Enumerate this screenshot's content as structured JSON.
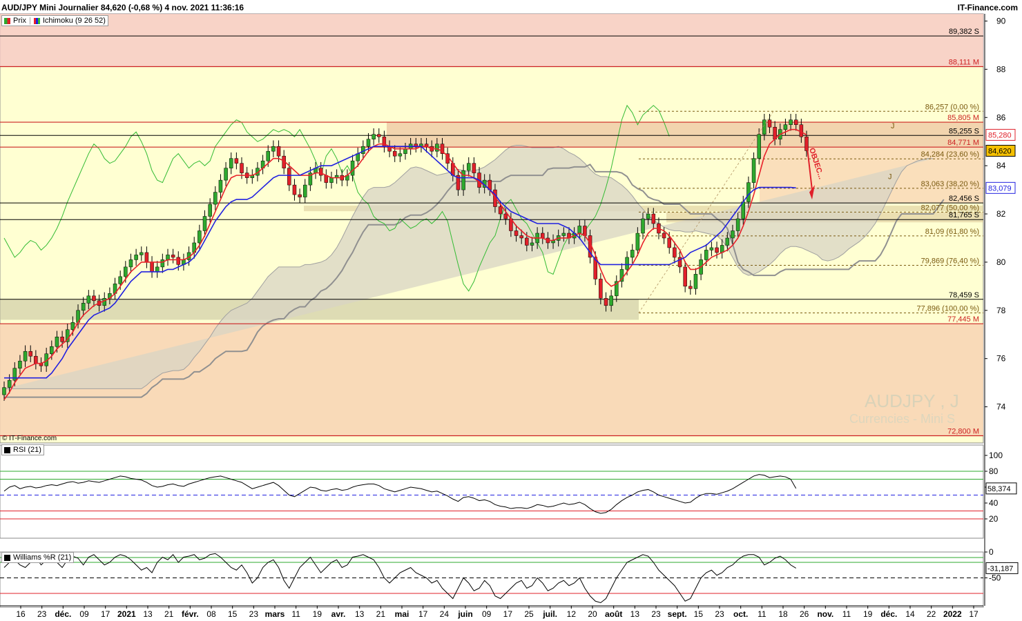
{
  "header": {
    "title": "AUD/JPY Mini Journalier 84,620 (-0,68 %) 4 nov. 2021 11:36:16",
    "brand": "IT-Finance.com",
    "copyright": "© IT-Finance.com",
    "watermark_symbol": "AUDJPY , J",
    "watermark_sub": "Currencies - Mini S"
  },
  "legends": {
    "price": "Prix",
    "ichimoku": "Ichimoku (9 26 52)",
    "rsi": "RSI (21)",
    "williams": "Williams %R (21)"
  },
  "colors": {
    "up": "#2ea82e",
    "down": "#e0202a",
    "tenkan": "#e8202a",
    "kijun": "#2020e0",
    "chikou": "#33bb33",
    "kumo_line": "#a0a0a0",
    "panel_bg": "#ffffd2"
  },
  "annotations": {
    "objective_label": "OBJEC...",
    "j_label": "J"
  },
  "chart_data": [
    {
      "type": "candlestick",
      "ylim": [
        72.5,
        90.3
      ],
      "y_ticks": [
        74,
        76,
        78,
        80,
        82,
        84,
        86,
        88,
        90
      ],
      "x_tick_labels": [
        "16",
        "23",
        "déc.",
        "09",
        "17",
        "2021",
        "13",
        "21",
        "févr.",
        "08",
        "15",
        "23",
        "mars",
        "11",
        "19",
        "avr.",
        "13",
        "21",
        "mai",
        "17",
        "24",
        "juin",
        "09",
        "17",
        "25",
        "juil.",
        "12",
        "20",
        "août",
        "13",
        "23",
        "sept.",
        "15",
        "23",
        "oct.",
        "11",
        "18",
        "26",
        "nov.",
        "11",
        "19",
        "déc.",
        "14",
        "22",
        "2022",
        "17"
      ],
      "price_levels": [
        {
          "value": 89.382,
          "label": "89,382 S",
          "color": "#000000"
        },
        {
          "value": 88.111,
          "label": "88,111 M",
          "color": "#cc2222"
        },
        {
          "value": 86.257,
          "label": "86,257 (0,00 %)",
          "color": "#7a5a10"
        },
        {
          "value": 85.805,
          "label": "85,805 M",
          "color": "#cc2222"
        },
        {
          "value": 85.255,
          "label": "85,255 S",
          "color": "#000000"
        },
        {
          "value": 84.771,
          "label": "84,771 M",
          "color": "#cc2222"
        },
        {
          "value": 84.284,
          "label": "84,284 (23,60 %)",
          "color": "#7a5a10"
        },
        {
          "value": 83.063,
          "label": "83,063 (38,20 %)",
          "color": "#7a5a10"
        },
        {
          "value": 82.456,
          "label": "82,456 S",
          "color": "#000000"
        },
        {
          "value": 82.077,
          "label": "82,077 (50,00 %)",
          "color": "#7a5a10"
        },
        {
          "value": 81.765,
          "label": "81,765 S",
          "color": "#000000"
        },
        {
          "value": 81.09,
          "label": "81,09 (61,80 %)",
          "color": "#7a5a10"
        },
        {
          "value": 79.869,
          "label": "79,869 (76,40 %)",
          "color": "#7a5a10"
        },
        {
          "value": 78.459,
          "label": "78,459 S",
          "color": "#000000"
        },
        {
          "value": 77.896,
          "label": "77,896 (100,00 %)",
          "color": "#7a5a10"
        },
        {
          "value": 77.445,
          "label": "77,445 M",
          "color": "#cc2222"
        },
        {
          "value": 72.8,
          "label": "72,800 M",
          "color": "#cc2222"
        }
      ],
      "current_price": {
        "value": 84.62,
        "label": "84,620"
      },
      "kijun_value": {
        "value": 83.079,
        "label": "83,079"
      },
      "tenkan_value": {
        "value": 85.28,
        "label": "85,280"
      },
      "close": [
        74.8,
        75.1,
        75.6,
        75.9,
        76.3,
        76.1,
        75.8,
        75.7,
        76.2,
        76.5,
        76.9,
        76.7,
        77.2,
        77.5,
        78.0,
        78.3,
        78.6,
        78.4,
        78.2,
        78.5,
        78.7,
        79.1,
        79.4,
        79.8,
        80.1,
        80.3,
        80.4,
        80.0,
        79.6,
        79.8,
        80.1,
        80.3,
        80.2,
        79.9,
        80.1,
        80.4,
        80.8,
        81.3,
        81.9,
        82.4,
        82.9,
        83.4,
        83.9,
        84.3,
        84.1,
        83.7,
        83.5,
        83.6,
        83.9,
        84.2,
        84.6,
        84.8,
        84.4,
        83.9,
        83.2,
        82.8,
        82.7,
        83.2,
        83.7,
        83.9,
        83.6,
        83.3,
        83.5,
        83.6,
        83.4,
        83.6,
        84.2,
        84.5,
        84.8,
        85.1,
        85.3,
        85.2,
        84.8,
        84.6,
        84.4,
        84.5,
        84.7,
        84.9,
        84.8,
        84.9,
        84.8,
        84.6,
        84.9,
        84.5,
        84.1,
        83.6,
        83.0,
        83.8,
        84.1,
        83.7,
        83.1,
        83.4,
        83.0,
        82.3,
        82.0,
        81.8,
        81.3,
        81.1,
        81.0,
        80.7,
        80.8,
        81.2,
        81.0,
        80.8,
        80.9,
        81.1,
        81.2,
        81.0,
        81.2,
        81.5,
        81.1,
        80.2,
        79.3,
        78.5,
        78.2,
        78.6,
        79.2,
        79.7,
        80.2,
        80.5,
        81.2,
        81.8,
        82.0,
        81.6,
        81.2,
        81.0,
        80.6,
        80.2,
        79.8,
        79.0,
        78.9,
        79.5,
        80.1,
        80.5,
        80.6,
        80.4,
        80.7,
        81.0,
        81.3,
        81.8,
        82.5,
        83.3,
        84.3,
        85.3,
        85.9,
        85.6,
        85.1,
        85.5,
        85.7,
        85.9,
        85.7,
        85.2,
        84.62
      ],
      "tenkan": [
        74.3,
        74.6,
        75.0,
        75.3,
        75.6,
        75.7,
        75.8,
        75.8,
        75.9,
        76.1,
        76.4,
        76.6,
        76.8,
        77.1,
        77.5,
        77.8,
        78.0,
        78.2,
        78.3,
        78.4,
        78.5,
        78.7,
        79.0,
        79.3,
        79.6,
        79.8,
        80.0,
        80.0,
        80.0,
        80.0,
        80.0,
        80.1,
        80.1,
        80.1,
        80.1,
        80.2,
        80.4,
        80.7,
        81.1,
        81.6,
        82.1,
        82.6,
        83.1,
        83.5,
        83.6,
        83.6,
        83.6,
        83.6,
        83.7,
        83.9,
        84.1,
        84.3,
        84.3,
        84.2,
        84.0,
        83.8,
        83.6,
        83.6,
        83.6,
        83.7,
        83.7,
        83.6,
        83.5,
        83.5,
        83.5,
        83.6,
        83.8,
        84.0,
        84.3,
        84.6,
        84.8,
        84.9,
        84.9,
        84.8,
        84.7,
        84.7,
        84.7,
        84.7,
        84.7,
        84.8,
        84.8,
        84.7,
        84.7,
        84.6,
        84.4,
        84.1,
        83.8,
        83.6,
        83.6,
        83.5,
        83.3,
        83.2,
        83.0,
        82.7,
        82.4,
        82.1,
        81.8,
        81.5,
        81.3,
        81.1,
        81.0,
        81.0,
        81.0,
        80.9,
        80.9,
        81.0,
        81.0,
        81.0,
        81.1,
        81.2,
        81.1,
        80.8,
        80.3,
        79.7,
        79.2,
        79.0,
        79.1,
        79.3,
        79.6,
        79.9,
        80.3,
        80.8,
        81.2,
        81.4,
        81.4,
        81.3,
        81.1,
        80.8,
        80.5,
        80.0,
        79.7,
        79.7,
        79.8,
        80.0,
        80.2,
        80.3,
        80.4,
        80.5,
        80.7,
        81.0,
        81.5,
        82.1,
        82.8,
        83.6,
        84.4,
        84.9,
        85.1,
        85.3,
        85.4,
        85.5,
        85.5,
        85.4,
        85.28
      ],
      "kijun": [
        75.2,
        75.2,
        75.2,
        75.2,
        75.2,
        75.2,
        75.2,
        75.2,
        75.2,
        75.4,
        75.7,
        76.0,
        76.4,
        76.7,
        77.0,
        77.3,
        77.6,
        77.8,
        77.9,
        78.0,
        78.1,
        78.3,
        78.6,
        78.9,
        79.2,
        79.4,
        79.6,
        79.6,
        79.6,
        79.6,
        79.6,
        79.7,
        79.7,
        79.8,
        79.9,
        80.0,
        80.2,
        80.5,
        80.9,
        81.3,
        81.7,
        82.0,
        82.3,
        82.5,
        82.6,
        82.6,
        82.6,
        82.7,
        82.9,
        83.1,
        83.3,
        83.5,
        83.6,
        83.6,
        83.6,
        83.6,
        83.6,
        83.7,
        83.8,
        83.9,
        84.0,
        84.0,
        84.0,
        84.1,
        84.2,
        84.3,
        84.4,
        84.5,
        84.6,
        84.7,
        84.8,
        84.8,
        84.8,
        84.8,
        84.8,
        84.8,
        84.8,
        84.8,
        84.8,
        84.8,
        84.6,
        84.4,
        84.2,
        84.0,
        83.8,
        83.6,
        83.5,
        83.5,
        83.5,
        83.5,
        83.4,
        83.2,
        83.0,
        82.8,
        82.5,
        82.3,
        82.1,
        82.0,
        81.9,
        81.8,
        81.7,
        81.6,
        81.6,
        81.6,
        81.6,
        81.6,
        81.5,
        81.4,
        81.2,
        81.0,
        80.7,
        80.4,
        80.1,
        79.9,
        79.9,
        79.9,
        79.9,
        79.9,
        79.9,
        79.9,
        79.9,
        79.9,
        79.9,
        79.9,
        79.9,
        79.9,
        79.9,
        80.0,
        80.1,
        80.2,
        80.4,
        80.5,
        80.6,
        80.7,
        80.9,
        81.1,
        81.3,
        81.6,
        81.9,
        82.2,
        82.5,
        82.8,
        83.0,
        83.1,
        83.1,
        83.1,
        83.1,
        83.1,
        83.1,
        83.1,
        83.079
      ]
    },
    {
      "type": "line",
      "name": "RSI (21)",
      "ylim": [
        0,
        100
      ],
      "y_ticks": [
        20,
        40,
        60,
        80,
        100
      ],
      "levels": [
        30,
        70,
        50
      ],
      "last": {
        "value": 58.374,
        "label": "58,374"
      },
      "values": [
        55,
        60,
        62,
        58,
        60,
        61,
        59,
        60,
        62,
        63,
        62,
        64,
        66,
        67,
        65,
        66,
        68,
        67,
        66,
        68,
        70,
        72,
        74,
        73,
        71,
        70,
        69,
        66,
        62,
        60,
        61,
        63,
        64,
        62,
        61,
        64,
        66,
        68,
        70,
        72,
        73,
        74,
        72,
        70,
        68,
        66,
        62,
        58,
        60,
        62,
        64,
        66,
        62,
        56,
        50,
        48,
        52,
        56,
        60,
        59,
        56,
        55,
        57,
        58,
        56,
        57,
        60,
        62,
        63,
        64,
        64,
        62,
        58,
        56,
        54,
        56,
        58,
        60,
        59,
        58,
        56,
        54,
        55,
        52,
        49,
        45,
        42,
        47,
        48,
        46,
        43,
        44,
        42,
        38,
        36,
        35,
        33,
        34,
        34,
        33,
        35,
        38,
        37,
        35,
        36,
        38,
        40,
        38,
        39,
        41,
        38,
        33,
        29,
        27,
        28,
        32,
        38,
        43,
        47,
        50,
        54,
        56,
        57,
        54,
        50,
        48,
        46,
        44,
        42,
        40,
        41,
        46,
        50,
        52,
        52,
        51,
        53,
        55,
        58,
        62,
        66,
        70,
        74,
        76,
        75,
        72,
        73,
        74,
        73,
        70,
        58.374
      ]
    },
    {
      "type": "line",
      "name": "Williams %R (21)",
      "ylim": [
        -100,
        0
      ],
      "y_ticks": [
        0,
        -50
      ],
      "levels": [
        -20,
        -80,
        -50
      ],
      "last": {
        "value": -31.187,
        "label": "-31,187"
      },
      "values": [
        -30,
        -20,
        -15,
        -25,
        -30,
        -20,
        -10,
        -25,
        -15,
        -10,
        -20,
        -30,
        -15,
        -8,
        -12,
        -25,
        -10,
        -5,
        -15,
        -25,
        -20,
        -10,
        -5,
        -8,
        -15,
        -25,
        -35,
        -30,
        -40,
        -20,
        -10,
        -15,
        -5,
        -20,
        -10,
        -8,
        -5,
        -15,
        -12,
        -5,
        -3,
        -10,
        -20,
        -30,
        -35,
        -25,
        -40,
        -60,
        -50,
        -30,
        -20,
        -15,
        -30,
        -55,
        -70,
        -50,
        -30,
        -20,
        -10,
        -25,
        -40,
        -30,
        -20,
        -15,
        -30,
        -25,
        -10,
        -8,
        -5,
        -10,
        -15,
        -30,
        -50,
        -60,
        -50,
        -40,
        -35,
        -30,
        -40,
        -45,
        -50,
        -60,
        -55,
        -70,
        -80,
        -90,
        -70,
        -50,
        -60,
        -75,
        -70,
        -55,
        -65,
        -85,
        -90,
        -80,
        -70,
        -60,
        -55,
        -70,
        -65,
        -50,
        -60,
        -75,
        -70,
        -60,
        -55,
        -65,
        -60,
        -50,
        -70,
        -85,
        -95,
        -98,
        -90,
        -70,
        -50,
        -35,
        -20,
        -15,
        -10,
        -5,
        -8,
        -20,
        -35,
        -45,
        -55,
        -65,
        -80,
        -95,
        -90,
        -70,
        -50,
        -40,
        -35,
        -45,
        -40,
        -30,
        -25,
        -15,
        -8,
        -5,
        -5,
        -10,
        -25,
        -20,
        -12,
        -8,
        -15,
        -25,
        -31.187
      ]
    }
  ]
}
